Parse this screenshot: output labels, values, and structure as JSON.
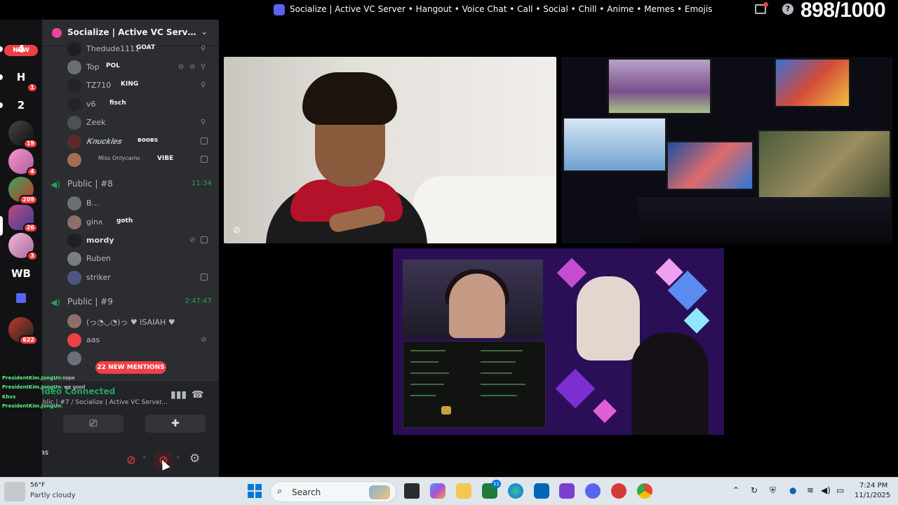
{
  "window": {
    "title": "Socialize | Active VC Server • Hangout • Voice Chat • Call • Social • Chill • Anime • Memes • Emojis",
    "overlay_counter": "898/1000"
  },
  "rail": {
    "new_label": "NEW",
    "items": [
      {
        "label": "4",
        "badge": ""
      },
      {
        "label": "H",
        "badge": "1"
      },
      {
        "label": "2",
        "badge": ""
      },
      {
        "label": "",
        "badge": "19"
      },
      {
        "label": "",
        "badge": "4"
      },
      {
        "label": "",
        "badge": "209"
      },
      {
        "label": "",
        "badge": "26"
      },
      {
        "label": "",
        "badge": "3"
      },
      {
        "label": "WB",
        "badge": ""
      },
      {
        "label": "",
        "badge": ""
      },
      {
        "label": "",
        "badge": "622"
      }
    ]
  },
  "server": {
    "name": "Socialize | Active VC Server • ..."
  },
  "members_top": [
    {
      "name": "Thedude1111",
      "tag": "GOAT"
    },
    {
      "name": "Top",
      "tag": "POL"
    },
    {
      "name": "TZ710",
      "tag": "KING"
    },
    {
      "name": "v6",
      "tag": "fisch"
    },
    {
      "name": "Zeek",
      "tag": ""
    },
    {
      "name": "𝑲𝒏𝒖𝒄𝒌𝒍𝒆𝒔",
      "tag": "ʙᴏᴏʙs"
    },
    {
      "name": "Miss Onlycams",
      "tag": "VIBE"
    }
  ],
  "voice_channels": [
    {
      "name": "Public | #8",
      "time": "11:34"
    },
    {
      "name": "Public | #9",
      "time": "2:47:47"
    }
  ],
  "members_8": [
    {
      "name": "B..."
    },
    {
      "name": "ginʌ",
      "tag": "goth"
    },
    {
      "name": "mordy"
    },
    {
      "name": "Ruben"
    },
    {
      "name": "striker"
    }
  ],
  "members_9": [
    {
      "name": "(っ◔◡◔)っ ♥ ISAIAH ♥"
    },
    {
      "name": "aas"
    }
  ],
  "mentions_label": "22 NEW MENTIONS",
  "voice_connection": {
    "status": "Video Connected",
    "channel": "Public | #7 / Socialize | Active VC Server..."
  },
  "user_panel": {
    "name": "Das"
  },
  "chat_overlay": [
    {
      "user": "PresidentKim.JongUn",
      "msg": ":nope"
    },
    {
      "user": "PresidentKim.JongUn",
      "msg": ": we good"
    },
    {
      "user": "Khvx",
      "msg": ""
    },
    {
      "user": "PresidentKim.JongUn",
      "msg": ":"
    }
  ],
  "taskbar": {
    "weather_temp": "56°F",
    "weather_desc": "Partly cloudy",
    "search_placeholder": "Search",
    "store_badge": "11",
    "time": "7:24 PM",
    "date": "11/1/2025"
  },
  "colors": {
    "accent": "#5865f2",
    "mention_red": "#f23f43",
    "voice_green": "#23a55a"
  }
}
